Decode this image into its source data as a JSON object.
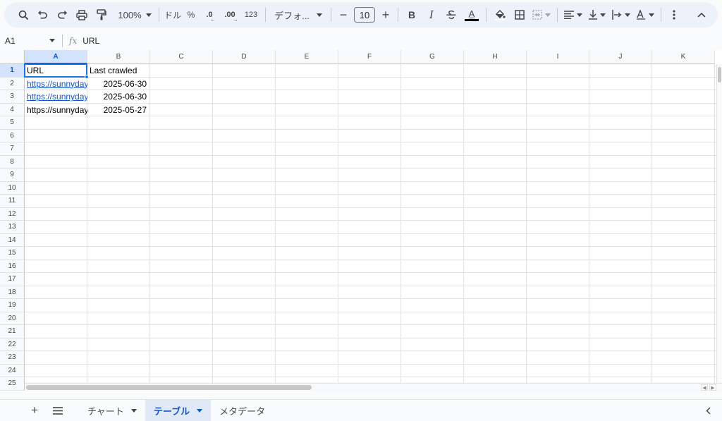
{
  "toolbar": {
    "zoom": "100%",
    "currency": "ドル",
    "percent": "%",
    "decrease_decimal": ".0",
    "increase_decimal": ".00",
    "number_format": "123",
    "font_family": "デフォ...",
    "font_size": "10",
    "minus": "−",
    "plus": "+",
    "bold": "B",
    "italic": "I",
    "text_color_letter": "A"
  },
  "formula_bar": {
    "cell_ref": "A1",
    "fx": "fx",
    "value": "URL"
  },
  "columns": [
    "A",
    "B",
    "C",
    "D",
    "E",
    "F",
    "G",
    "H",
    "I",
    "J",
    "K"
  ],
  "rows": [
    "1",
    "2",
    "3",
    "4",
    "5",
    "6",
    "7",
    "8",
    "9",
    "10",
    "11",
    "12",
    "13",
    "14",
    "15",
    "16",
    "17",
    "18",
    "19",
    "20",
    "21",
    "22",
    "23",
    "24",
    "25"
  ],
  "data": [
    {
      "a": "URL",
      "b": "Last crawled"
    },
    {
      "a": "https://sunnyday",
      "b": "2025-06-30"
    },
    {
      "a": "https://sunnyday",
      "b": "2025-06-30"
    },
    {
      "a": "https://sunnyday",
      "b": "2025-05-27"
    }
  ],
  "selected_cell": "A1",
  "sheets": [
    {
      "label": "チャート",
      "active": false
    },
    {
      "label": "テーブル",
      "active": true
    },
    {
      "label": "メタデータ",
      "active": false
    }
  ],
  "colors": {
    "accent": "#0b57d0",
    "link": "#1155cc",
    "selection": "#1a73e8",
    "toolbar_bg": "#edf2fa"
  }
}
